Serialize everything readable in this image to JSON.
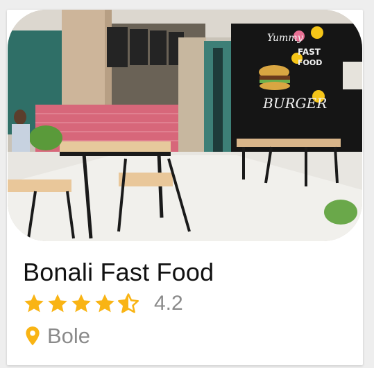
{
  "restaurant": {
    "name": "Bonali Fast Food",
    "rating": 4.2,
    "rating_label": "4.2",
    "stars": [
      "full",
      "full",
      "full",
      "full",
      "half"
    ],
    "location": "Bole",
    "photo_signage": {
      "top": "Yummy",
      "fast_food": "FAST FOOD",
      "burger": "BURGER"
    }
  },
  "colors": {
    "star": "#f9b414",
    "pin": "#f9b414",
    "secondary_text": "#8a8a8a",
    "title_text": "#111111"
  },
  "icons": {
    "star_full": "star-icon",
    "star_half": "star-half-icon",
    "pin": "location-pin-icon"
  }
}
